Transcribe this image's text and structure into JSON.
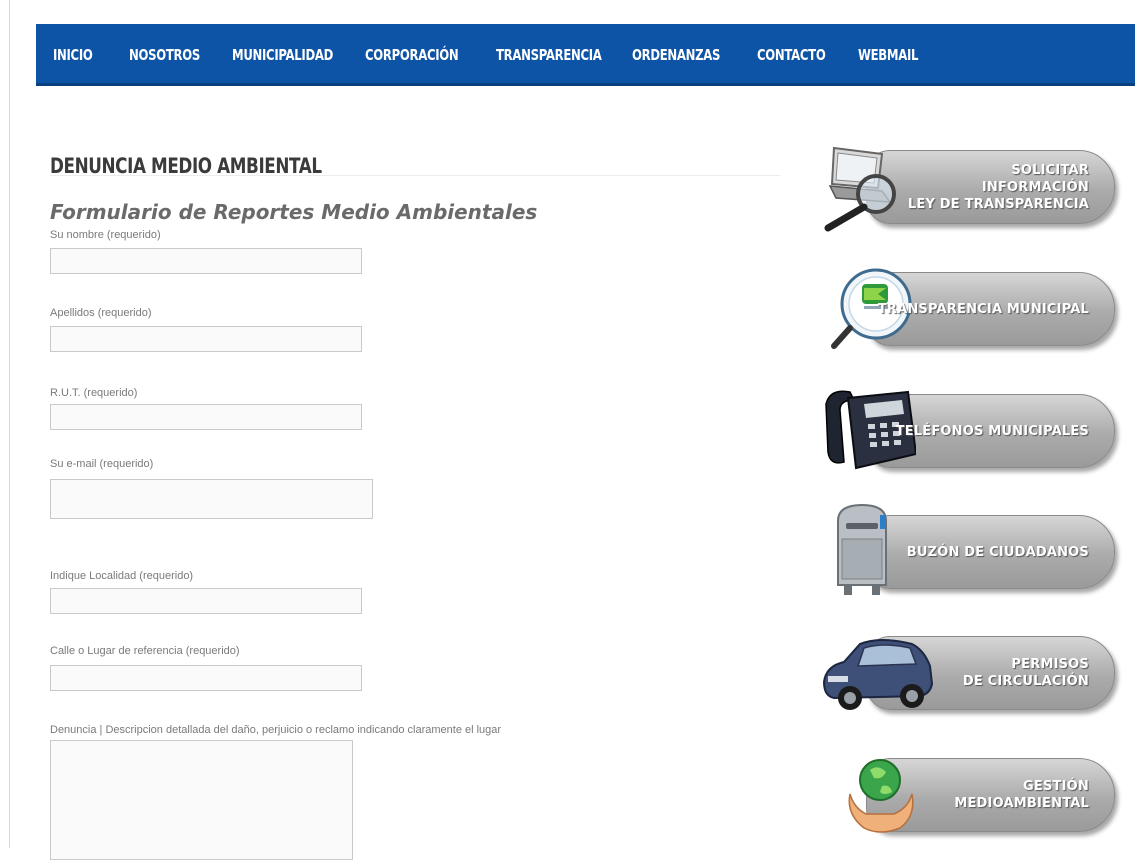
{
  "nav": {
    "items": [
      "INICIO",
      "NOSOTROS",
      "MUNICIPALIDAD",
      "CORPORACIÓN",
      "TRANSPARENCIA",
      "ORDENANZAS",
      "CONTACTO",
      "WEBMAIL"
    ]
  },
  "page": {
    "title": "DENUNCIA MEDIO AMBIENTAL",
    "subtitle": "Formulario de Reportes Medio Ambientales"
  },
  "form": {
    "fields": [
      {
        "label": "Su nombre (requerido)",
        "value": ""
      },
      {
        "label": "Apellidos (requerido)",
        "value": ""
      },
      {
        "label": "R.U.T. (requerido)",
        "value": ""
      },
      {
        "label": "Su e-mail (requerido)",
        "value": ""
      },
      {
        "label": "Indique Localidad (requerido)",
        "value": ""
      },
      {
        "label": "Calle o Lugar de referencia (requerido)",
        "value": ""
      },
      {
        "label": "Denuncia | Descripcion detallada del daño, perjuicio o reclamo indicando claramente el lugar",
        "value": ""
      }
    ]
  },
  "sidebar": {
    "banners": [
      {
        "lines": [
          "SOLICITAR",
          "INFORMACIÓN",
          "LEY DE TRANSPARENCIA"
        ],
        "icon": "magnifier-laptop-icon"
      },
      {
        "lines": [
          "TRANSPARENCIA MUNICIPAL"
        ],
        "icon": "transparency-seal-icon"
      },
      {
        "lines": [
          "TELÉFONOS MUNICIPALES"
        ],
        "icon": "desk-phone-icon"
      },
      {
        "lines": [
          "BUZÓN DE CIUDADANOS"
        ],
        "icon": "mailbox-icon"
      },
      {
        "lines": [
          "PERMISOS",
          "DE CIRCULACIÓN"
        ],
        "icon": "car-icon"
      },
      {
        "lines": [
          "GESTIÓN",
          "MEDIOAMBIENTAL"
        ],
        "icon": "globe-hands-icon"
      }
    ]
  },
  "colors": {
    "nav_bg": "#0e54a6",
    "nav_text": "#ffffff",
    "banner_gray": "#ababab"
  }
}
